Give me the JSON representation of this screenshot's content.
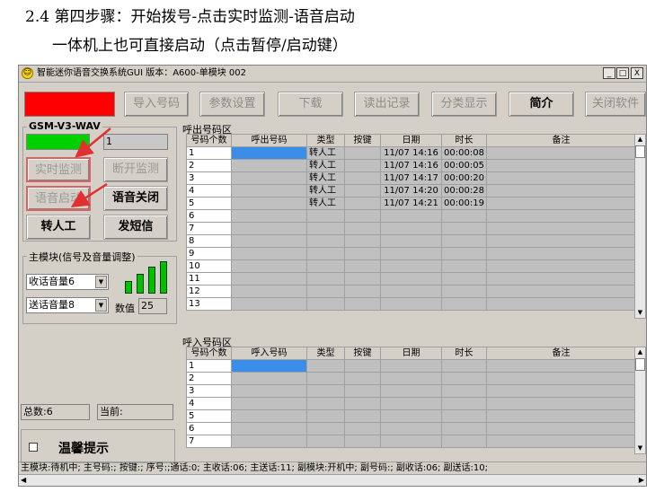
{
  "doc": {
    "step_heading": "2.4 第四步骤：开始拨号-点击实时监测-语音启动",
    "step_note": "一体机上也可直接启动（点击暂停/启动键）"
  },
  "window": {
    "title": "智能迷你语音交换系统GUI 版本：A600-单模块 002",
    "minimize_label": "_",
    "maximize_label": "□",
    "close_label": "X"
  },
  "toolbar": {
    "import_label": "导入号码",
    "params_label": "参数设置",
    "download_label": "下载",
    "read_log_label": "读出记录",
    "classify_label": "分类显示",
    "intro_label": "简介",
    "close_software_label": "关闭软件"
  },
  "left": {
    "module_group": "GSM-V3-WAV",
    "channel_value": "1",
    "realtime_monitor": "实时监测",
    "disconnect_monitor": "断开监测",
    "voice_start": "语音启动",
    "voice_close": "语音关闭",
    "to_manual": "转人工",
    "send_sms": "发短信",
    "volume_group": "主模块(信号及音量调整)",
    "receive_volume": "收话音量6",
    "send_volume": "送话音量8",
    "value_label": "数值",
    "value": "25",
    "signal_bars_lit": 4,
    "signal_bars_total": 4,
    "total_label": "总数:6",
    "current_label": "当前:",
    "tips_label": "温馨提示",
    "tips_checked": false
  },
  "outgoing": {
    "title": "呼出号码区",
    "columns": [
      "号码个数",
      "呼出号码",
      "类型",
      "按键",
      "日期",
      "时长",
      "备注"
    ],
    "rows": [
      [
        "1",
        "",
        "转人工",
        "",
        "11/07 14:16",
        "00:00:08",
        ""
      ],
      [
        "2",
        "",
        "转人工",
        "",
        "11/07 14:16",
        "00:00:05",
        ""
      ],
      [
        "3",
        "",
        "转人工",
        "",
        "11/07 14:17",
        "00:00:20",
        ""
      ],
      [
        "4",
        "",
        "转人工",
        "",
        "11/07 14:20",
        "00:00:28",
        ""
      ],
      [
        "5",
        "",
        "转人工",
        "",
        "11/07 14:21",
        "00:00:19",
        ""
      ],
      [
        "6",
        "",
        "",
        "",
        "",
        "",
        ""
      ],
      [
        "7",
        "",
        "",
        "",
        "",
        "",
        ""
      ],
      [
        "8",
        "",
        "",
        "",
        "",
        "",
        ""
      ],
      [
        "9",
        "",
        "",
        "",
        "",
        "",
        ""
      ],
      [
        "10",
        "",
        "",
        "",
        "",
        "",
        ""
      ],
      [
        "11",
        "",
        "",
        "",
        "",
        "",
        ""
      ],
      [
        "12",
        "",
        "",
        "",
        "",
        "",
        ""
      ],
      [
        "13",
        "",
        "",
        "",
        "",
        "",
        ""
      ]
    ]
  },
  "incoming": {
    "title": "呼入号码区",
    "columns": [
      "号码个数",
      "呼入号码",
      "类型",
      "按键",
      "日期",
      "时长",
      "备注"
    ],
    "rows": [
      [
        "1",
        "",
        "",
        "",
        "",
        "",
        ""
      ],
      [
        "2",
        "",
        "",
        "",
        "",
        "",
        ""
      ],
      [
        "3",
        "",
        "",
        "",
        "",
        "",
        ""
      ],
      [
        "4",
        "",
        "",
        "",
        "",
        "",
        ""
      ],
      [
        "5",
        "",
        "",
        "",
        "",
        "",
        ""
      ],
      [
        "6",
        "",
        "",
        "",
        "",
        "",
        ""
      ],
      [
        "7",
        "",
        "",
        "",
        "",
        "",
        ""
      ]
    ]
  },
  "status_bar": "主模块:待机中; 主号码:; 按键:; 序号:;通话:0; 主收话:06; 主送话:11; 副模块:开机中; 副号码:; 副收话:06; 副送话:10;",
  "colors": {
    "indicator_red": "#ff0000",
    "indicator_green": "#00d000",
    "selection_blue": "#3b8ee8",
    "annotation_red": "#e03030"
  },
  "icons": {
    "app": "smiley-icon",
    "scroll_up": "chevron-up-icon",
    "scroll_down": "chevron-down-icon"
  }
}
